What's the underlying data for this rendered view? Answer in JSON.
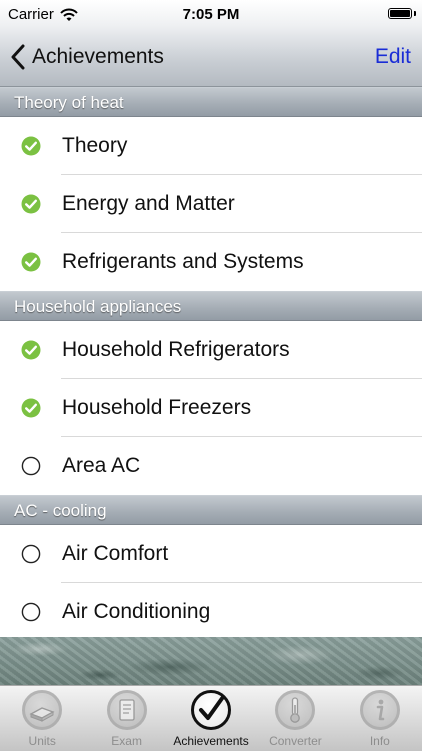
{
  "status_bar": {
    "carrier": "Carrier",
    "time": "7:05 PM"
  },
  "nav": {
    "title": "Achievements",
    "edit_label": "Edit"
  },
  "sections": [
    {
      "title": "Theory of heat",
      "items": [
        {
          "label": "Theory",
          "completed": true
        },
        {
          "label": "Energy and Matter",
          "completed": true
        },
        {
          "label": "Refrigerants and Systems",
          "completed": true
        }
      ]
    },
    {
      "title": "Household appliances",
      "items": [
        {
          "label": "Household Refrigerators",
          "completed": true
        },
        {
          "label": "Household Freezers",
          "completed": true
        },
        {
          "label": "Area AC",
          "completed": false
        }
      ]
    },
    {
      "title": "AC - cooling",
      "items": [
        {
          "label": "Air Comfort",
          "completed": false
        },
        {
          "label": "Air Conditioning",
          "completed": false
        }
      ]
    }
  ],
  "tabs": [
    {
      "label": "Units",
      "icon": "book-icon",
      "active": false
    },
    {
      "label": "Exam",
      "icon": "exam-icon",
      "active": false
    },
    {
      "label": "Achievements",
      "icon": "checkmark-icon",
      "active": true
    },
    {
      "label": "Converter",
      "icon": "thermometer-icon",
      "active": false
    },
    {
      "label": "Info",
      "icon": "info-icon",
      "active": false
    }
  ],
  "colors": {
    "completed_green": "#7bc142",
    "edit_blue": "#1a2dd6"
  }
}
